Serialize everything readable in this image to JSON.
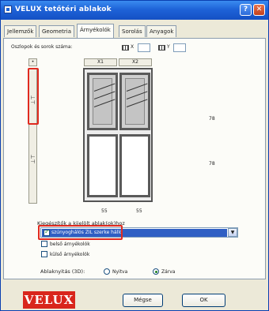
{
  "window": {
    "title": "VELUX tetőtéri ablakok",
    "help_glyph": "?",
    "close_glyph": "✕"
  },
  "tabs": [
    {
      "label": "Jellemzők"
    },
    {
      "label": "Geometria"
    },
    {
      "label": "Árnyékolók"
    },
    {
      "label": "Sorolás"
    },
    {
      "label": "Anyagok"
    }
  ],
  "active_tab": "Árnyékolók",
  "grid_settings": {
    "label": "Oszlopok és sorok száma:",
    "x_label": "X",
    "y_label": "Y"
  },
  "columns": {
    "dot": "•",
    "headers": [
      "X1",
      "X2"
    ],
    "widths": [
      "55",
      "55"
    ]
  },
  "rows": {
    "heights": [
      "78",
      "78"
    ]
  },
  "accessories": {
    "label": "Kiegészítők a kijelölt ablak(ok)hoz",
    "selected_option": "szúnyoghálós ZIL szerke hálló",
    "options": [
      {
        "label": "belső árnyékolók",
        "checked": false
      },
      {
        "label": "külső árnyékolók",
        "checked": false
      }
    ],
    "dropdown_glyph": "▼"
  },
  "opening": {
    "label": "Ablaknyitás (3D):",
    "options": [
      {
        "label": "Nyitva",
        "selected": false
      },
      {
        "label": "Zárva",
        "selected": true
      }
    ]
  },
  "footer": {
    "logo_text": "VELUX",
    "cancel_label": "Mégse",
    "ok_label": "OK"
  },
  "colors": {
    "highlight": "#e02a20",
    "selection": "#2f5fc4",
    "brand": "#d9261c"
  }
}
